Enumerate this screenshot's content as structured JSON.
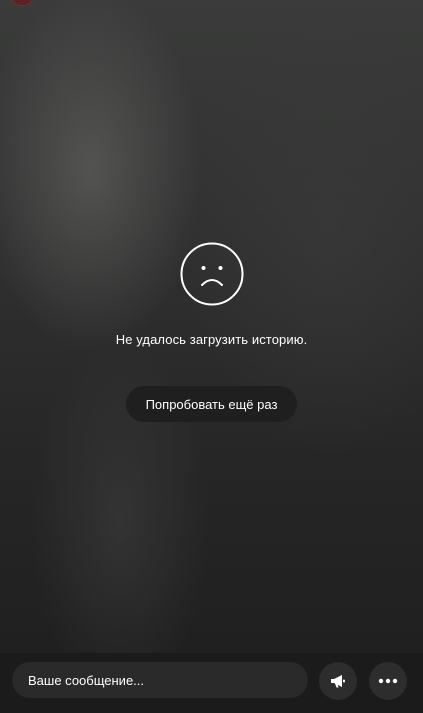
{
  "story": {
    "error_message": "Не удалось загрузить историю.",
    "retry_label": "Попробовать ещё раз",
    "icon": "sad-face-icon"
  },
  "composer": {
    "placeholder": "Ваше сообщение...",
    "value": "",
    "icons": [
      "megaphone-icon",
      "more-dots-icon"
    ]
  },
  "colors": {
    "background": "#2f302f",
    "button_bg": "#1f1f1f",
    "text": "#ffffff"
  }
}
